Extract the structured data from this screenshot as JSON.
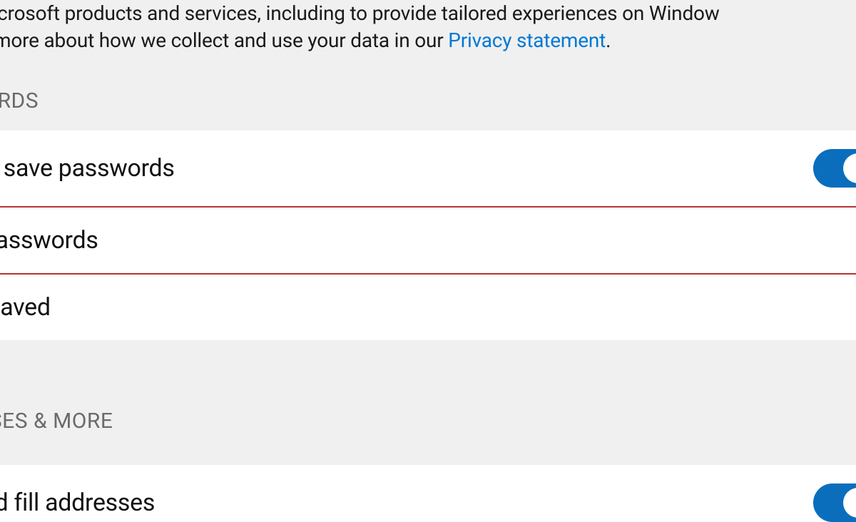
{
  "intro": {
    "line1_partial": "ss Microsoft products and services, including to provide tailored experiences on Window",
    "line2_prefix": "earn more about how we collect and use your data in our ",
    "privacy_link": "Privacy statement",
    "period": "."
  },
  "sections": {
    "passwords": {
      "header": "SWORDS",
      "rows": {
        "offer": "er to save passwords",
        "saved": "ed passwords",
        "never": "ver saved"
      }
    },
    "addresses": {
      "header": "RESSES & MORE",
      "rows": {
        "save_fill": "e and fill addresses"
      }
    }
  }
}
